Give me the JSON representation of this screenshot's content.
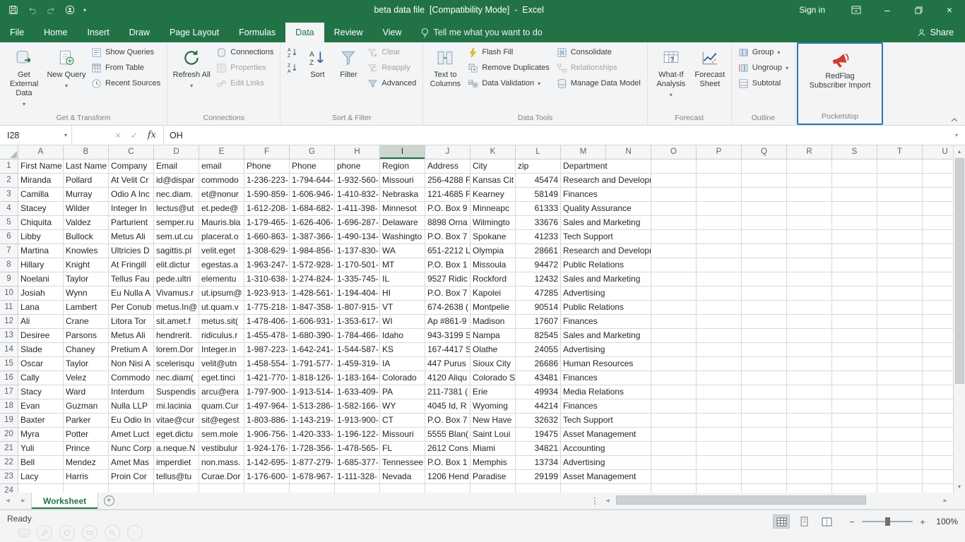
{
  "titlebar": {
    "title": "beta data file  [Compatibility Mode]  -  Excel",
    "sign_in": "Sign in"
  },
  "tabs": {
    "file": "File",
    "home": "Home",
    "insert": "Insert",
    "draw": "Draw",
    "page_layout": "Page Layout",
    "formulas": "Formulas",
    "data": "Data",
    "review": "Review",
    "view": "View",
    "tell_me": "Tell me what you want to do",
    "share": "Share"
  },
  "ribbon": {
    "get_external_data": "Get External Data",
    "new_query": "New Query",
    "show_queries": "Show Queries",
    "from_table": "From Table",
    "recent_sources": "Recent Sources",
    "group_get_transform": "Get & Transform",
    "refresh_all": "Refresh All",
    "connections": "Connections",
    "properties": "Properties",
    "edit_links": "Edit Links",
    "group_connections": "Connections",
    "sort": "Sort",
    "filter": "Filter",
    "clear": "Clear",
    "reapply": "Reapply",
    "advanced": "Advanced",
    "group_sort_filter": "Sort & Filter",
    "text_to_columns": "Text to Columns",
    "flash_fill": "Flash Fill",
    "remove_duplicates": "Remove Duplicates",
    "data_validation": "Data Validation",
    "consolidate": "Consolidate",
    "relationships": "Relationships",
    "manage_data_model": "Manage Data Model",
    "group_data_tools": "Data Tools",
    "what_if_analysis": "What-If Analysis",
    "forecast_sheet": "Forecast Sheet",
    "group_forecast": "Forecast",
    "group_button": "Group",
    "ungroup": "Ungroup",
    "subtotal": "Subtotal",
    "group_outline": "Outline",
    "redflag_subscriber_import": "RedFlag Subscriber Import",
    "group_pocketstop": "Pocketstop"
  },
  "formula_bar": {
    "name_box": "I28",
    "fx": "fx",
    "value": "OH"
  },
  "grid": {
    "columns": [
      "A",
      "B",
      "C",
      "D",
      "E",
      "F",
      "G",
      "H",
      "I",
      "J",
      "K",
      "L",
      "M",
      "N",
      "O",
      "P",
      "Q",
      "R",
      "S",
      "T",
      "U"
    ],
    "selected_column": "I",
    "rows": [
      [
        "First Name",
        "Last Name",
        "Company",
        "Email",
        "email",
        "Phone",
        "Phone",
        "phone",
        "Region",
        "Address",
        "City",
        "zip",
        "Department"
      ],
      [
        "Miranda",
        "Pollard",
        "At Velit Cr",
        "id@dispar",
        "commodo",
        "1-236-223-",
        "1-794-644-",
        "1-932-560-",
        "Missouri",
        "256-4288 F",
        "Kansas Cit",
        "45474",
        "Research and Development"
      ],
      [
        "Camilla",
        "Murray",
        "Odio A Inc",
        "nec.diam.",
        "et@nonur",
        "1-590-859-",
        "1-606-946-",
        "1-410-832-",
        "Nebraska",
        "121-4685 F",
        "Kearney",
        "58149",
        "Finances"
      ],
      [
        "Stacey",
        "Wilder",
        "Integer In",
        "lectus@ut",
        "et.pede@",
        "1-612-208-",
        "1-684-682-",
        "1-411-398-",
        "Minnesot",
        "P.O. Box 9",
        "Minneapc",
        "61333",
        "Quality Assurance"
      ],
      [
        "Chiquita",
        "Valdez",
        "Parturient",
        "semper.ru",
        "Mauris.bla",
        "1-179-465-",
        "1-626-406-",
        "1-696-287-",
        "Delaware",
        "8898 Orna",
        "Wilmingto",
        "33676",
        "Sales and Marketing"
      ],
      [
        "Libby",
        "Bullock",
        "Metus Ali",
        "sem.ut.cu",
        "placerat.o",
        "1-660-863-",
        "1-387-366-",
        "1-490-134-",
        "Washingto",
        "P.O. Box 7",
        "Spokane",
        "41233",
        "Tech Support"
      ],
      [
        "Martina",
        "Knowles",
        "Ultricies D",
        "sagittis.pl",
        "velit.eget",
        "1-308-629-",
        "1-984-856-",
        "1-137-830-",
        "WA",
        "651-2212 L",
        "Olympia",
        "28661",
        "Research and Development"
      ],
      [
        "Hillary",
        "Knight",
        "At Fringill",
        "elit.dictur",
        "egestas.a",
        "1-963-247-",
        "1-572-928-",
        "1-170-501-",
        "MT",
        "P.O. Box 1",
        "Missoula",
        "94472",
        "Public Relations"
      ],
      [
        "Noelani",
        "Taylor",
        "Tellus Fau",
        "pede.ultri",
        "elementu",
        "1-310-638-",
        "1-274-824-",
        "1-335-745-",
        "IL",
        "9527 Ridic",
        "Rockford",
        "12432",
        "Sales and Marketing"
      ],
      [
        "Josiah",
        "Wynn",
        "Eu Nulla A",
        "Vivamus.r",
        "ut.ipsum@",
        "1-923-913-",
        "1-428-561-",
        "1-194-404-",
        "HI",
        "P.O. Box 7",
        "Kapolei",
        "47285",
        "Advertising"
      ],
      [
        "Lana",
        "Lambert",
        "Per Conub",
        "metus.In@",
        "ut.quam.v",
        "1-775-218-",
        "1-847-358-",
        "1-807-915-",
        "VT",
        "674-2638 (",
        "Montpelie",
        "90514",
        "Public Relations"
      ],
      [
        "Ali",
        "Crane",
        "Litora Tor",
        "sit.amet.f",
        "metus.sit(",
        "1-478-406-",
        "1-606-931-",
        "1-353-617-",
        "WI",
        "Ap #861-9",
        "Madison",
        "17607",
        "Finances"
      ],
      [
        "Desiree",
        "Parsons",
        "Metus Ali",
        "hendrerit.",
        "ridiculus.r",
        "1-455-478-",
        "1-680-390-",
        "1-784-466-",
        "Idaho",
        "943-3199 S",
        "Nampa",
        "82545",
        "Sales and Marketing"
      ],
      [
        "Slade",
        "Chaney",
        "Pretium A",
        "lorem.Dor",
        "Integer.in",
        "1-987-223-",
        "1-642-241-",
        "1-544-587-",
        "KS",
        "167-4417 S",
        "Olathe",
        "24055",
        "Advertising"
      ],
      [
        "Oscar",
        "Taylor",
        "Non Nisi A",
        "scelerisqu",
        "velit@utn",
        "1-458-554-",
        "1-791-577-",
        "1-459-319-",
        "IA",
        "447 Purus",
        "Sioux City",
        "26686",
        "Human Resources"
      ],
      [
        "Cally",
        "Velez",
        "Commodo",
        "nec.diam(",
        "eget.tinci",
        "1-421-770-",
        "1-818-126-",
        "1-183-164-",
        "Colorado",
        "4120 Aliqu",
        "Colorado S",
        "43481",
        "Finances"
      ],
      [
        "Stacy",
        "Ward",
        "Interdum",
        "Suspendis",
        "arcu@era",
        "1-797-900-",
        "1-913-514-",
        "1-633-409-",
        "PA",
        "211-7381 (",
        "Erie",
        "49934",
        "Media Relations"
      ],
      [
        "Evan",
        "Guzman",
        "Nulla LLP",
        "mi.lacinia",
        "quam.Cur",
        "1-497-964-",
        "1-513-286-",
        "1-582-166-",
        "WY",
        "4045 Id, R",
        "Wyoming",
        "44214",
        "Finances"
      ],
      [
        "Baxter",
        "Parker",
        "Eu Odio In",
        "vitae@cur",
        "sit@egest",
        "1-803-886-",
        "1-143-219-",
        "1-913-900-",
        "CT",
        "P.O. Box 7",
        "New Have",
        "32632",
        "Tech Support"
      ],
      [
        "Myra",
        "Potter",
        "Amet Luct",
        "eget.dictu",
        "sem.mole",
        "1-906-756-",
        "1-420-333-",
        "1-196-122-",
        "Missouri",
        "5555 Blan(",
        "Saint Loui",
        "19475",
        "Asset Management"
      ],
      [
        "Yuli",
        "Prince",
        "Nunc Corp",
        "a.neque.N",
        "vestibulur",
        "1-924-176-",
        "1-728-356-",
        "1-478-565-",
        "FL",
        "2612 Cons",
        "Miami",
        "34821",
        "Accounting"
      ],
      [
        "Bell",
        "Mendez",
        "Amet Mas",
        "imperdiet",
        "non.mass.",
        "1-142-695-",
        "1-877-279-",
        "1-685-377-",
        "Tennessee",
        "P.O. Box 1",
        "Memphis",
        "13734",
        "Advertising"
      ],
      [
        "Lacy",
        "Harris",
        "Proin Cor",
        "tellus@tu",
        "Curae.Dor",
        "1-176-600-",
        "1-678-967-",
        "1-111-328-",
        "Nevada",
        "1206 Hend",
        "Paradise",
        "29199",
        "Asset Management"
      ]
    ]
  },
  "sheet_bar": {
    "active_tab": "Worksheet"
  },
  "status_bar": {
    "mode": "Ready",
    "zoom_level": "100%"
  }
}
